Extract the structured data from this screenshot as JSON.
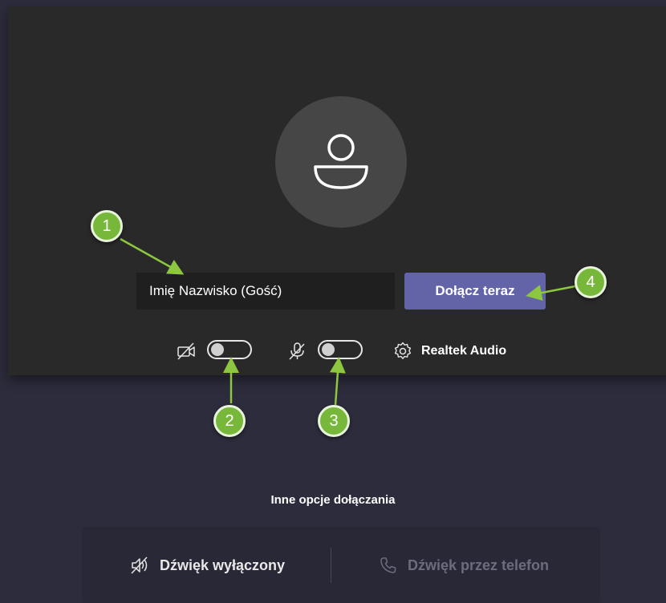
{
  "pre_join": {
    "name_value": "Imię Nazwisko (Gość)",
    "join_button_label": "Dołącz teraz",
    "camera_toggle_on": false,
    "mic_toggle_on": false,
    "audio_device_label": "Realtek Audio"
  },
  "annotations": [
    "1",
    "2",
    "3",
    "4"
  ],
  "other_options": {
    "title": "Inne opcje dołączania",
    "audio_off_label": "Dźwięk wyłączony",
    "phone_audio_label": "Dźwięk przez telefon"
  },
  "colors": {
    "accent": "#6264a7",
    "panel": "#292929",
    "background": "#2d2c3c",
    "badge": "#77b83a"
  }
}
